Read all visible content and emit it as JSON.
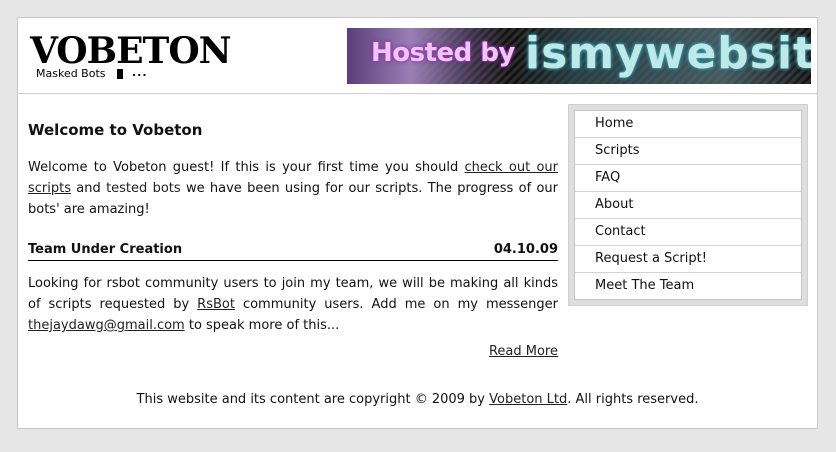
{
  "logo": {
    "wordmark": "VOBETON",
    "tagline": "Masked Bots",
    "dots": "..."
  },
  "banner": {
    "hosted_by": "Hosted by",
    "site": "ismywebsite"
  },
  "main": {
    "heading": "Welcome to Vobeton",
    "intro": {
      "part1": "Welcome to Vobeton guest! If this is your first time you should ",
      "link1": "check out our scripts",
      "part2": " and ",
      "plain": "tested bots",
      "part3": " we have been using for our scripts. The progress of our bots' are amazing!"
    },
    "post": {
      "title": "Team Under Creation",
      "date": "04.10.09",
      "body": {
        "part1": "Looking for rsbot community users to join my team, we will be making all kinds of scripts requested by ",
        "link1": "RsBot",
        "part2": " community users. Add me on my messenger ",
        "email": "thejaydawg@gmail.com",
        "part3": " to speak more of this..."
      },
      "read_more": "Read More"
    }
  },
  "sidebar": {
    "items": [
      {
        "label": "Home"
      },
      {
        "label": "Scripts"
      },
      {
        "label": "FAQ"
      },
      {
        "label": "About"
      },
      {
        "label": "Contact"
      },
      {
        "label": "Request a Script!"
      },
      {
        "label": "Meet The Team"
      }
    ]
  },
  "footer": {
    "part1": "This website and its content are copyright © 2009 by ",
    "link": "Vobeton Ltd",
    "part2": ". All rights reserved."
  }
}
